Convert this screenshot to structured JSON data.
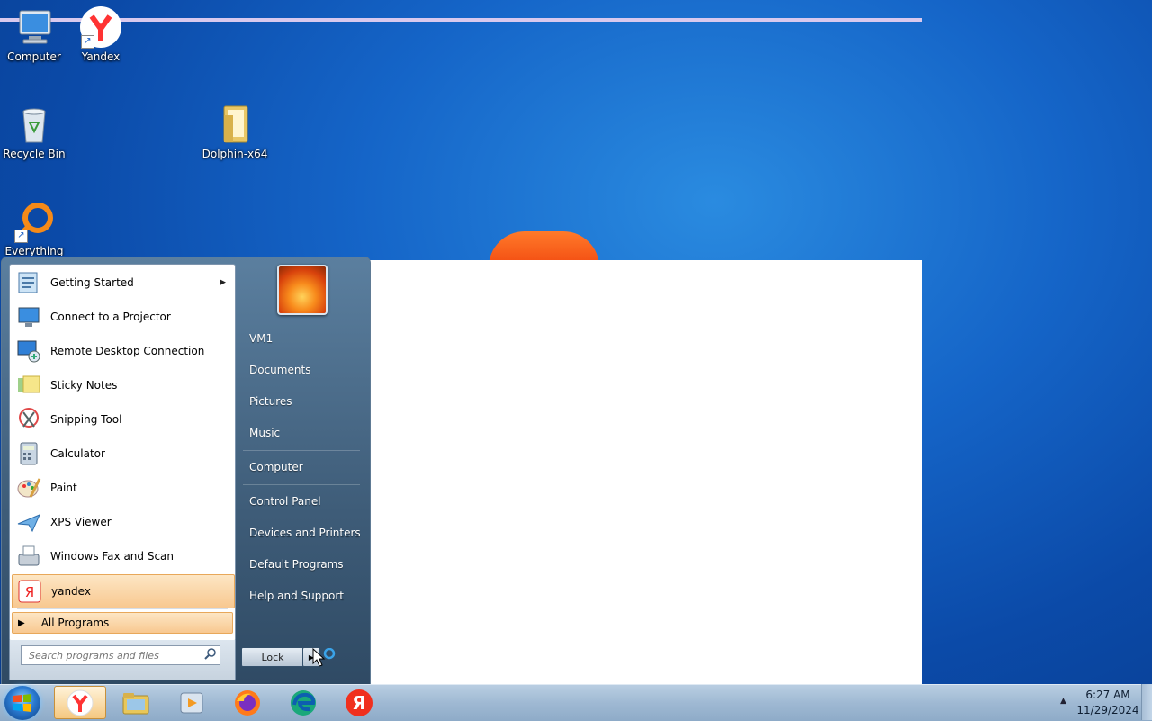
{
  "desktop": {
    "icons": [
      {
        "label": "Computer"
      },
      {
        "label": "Yandex"
      },
      {
        "label": "Recycle Bin"
      },
      {
        "label": "Dolphin-x64"
      },
      {
        "label": "Everything"
      }
    ]
  },
  "start_menu": {
    "programs": [
      {
        "label": "Getting Started",
        "icon": "getting-started-icon"
      },
      {
        "label": "Connect to a Projector",
        "icon": "projector-icon"
      },
      {
        "label": "Remote Desktop Connection",
        "icon": "remote-desktop-icon"
      },
      {
        "label": "Sticky Notes",
        "icon": "sticky-notes-icon"
      },
      {
        "label": "Snipping Tool",
        "icon": "snipping-tool-icon"
      },
      {
        "label": "Calculator",
        "icon": "calculator-icon"
      },
      {
        "label": "Paint",
        "icon": "paint-icon"
      },
      {
        "label": "XPS Viewer",
        "icon": "xps-viewer-icon"
      },
      {
        "label": "Windows Fax and Scan",
        "icon": "fax-scan-icon"
      },
      {
        "label": "yandex",
        "icon": "yandex-icon"
      }
    ],
    "all_programs": "All Programs",
    "search_placeholder": "Search programs and files",
    "right_items": [
      {
        "label": "VM1"
      },
      {
        "label": "Documents"
      },
      {
        "label": "Pictures"
      },
      {
        "label": "Music"
      },
      {
        "label": "Computer"
      },
      {
        "label": "Control Panel"
      },
      {
        "label": "Devices and Printers"
      },
      {
        "label": "Default Programs"
      },
      {
        "label": "Help and Support"
      }
    ],
    "lock_label": "Lock"
  },
  "taskbar": {
    "apps": [
      {
        "name": "yandex-browser"
      },
      {
        "name": "file-explorer"
      },
      {
        "name": "media-player"
      },
      {
        "name": "firefox"
      },
      {
        "name": "edge"
      },
      {
        "name": "yandex"
      }
    ]
  },
  "clock": {
    "time": "6:27 AM",
    "date": "11/29/2024"
  },
  "colors": {
    "desktop_blue": "#1565c8",
    "highlight": "#f8c890",
    "taskbar": "#9fb9d3"
  }
}
